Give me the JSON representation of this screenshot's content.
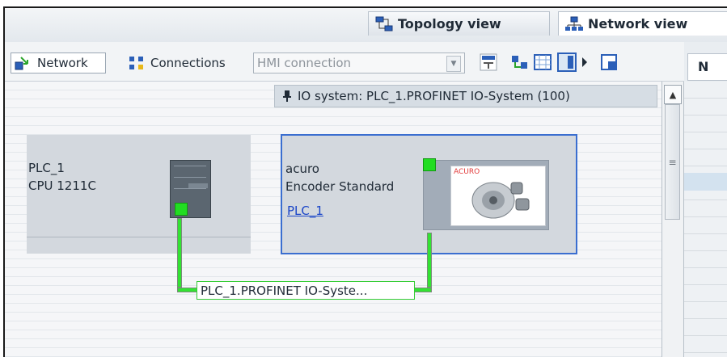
{
  "tabs": {
    "topology": "Topology view",
    "network": "Network view",
    "right_tab": "N"
  },
  "toolbar": {
    "network_label": "Network",
    "connections_label": "Connections",
    "connection_type": {
      "selected": "HMI connection"
    },
    "icons": [
      "name-icon",
      "network-conn-icon",
      "grid-icon",
      "panel-icon",
      "more-arrow-icon",
      "overview-icon"
    ]
  },
  "canvas": {
    "io_system_banner": "IO system: PLC_1.PROFINET IO-System (100)",
    "devices": [
      {
        "name": "PLC_1",
        "type": "CPU 1211C"
      },
      {
        "name": "acuro",
        "type": "Encoder Standard",
        "controller_link": "PLC_1",
        "brand": "ACURO"
      }
    ],
    "subnet_label": "PLC_1.PROFINET IO-Syste..."
  },
  "colors": {
    "port_green": "#22dd22",
    "selection_blue": "#3a6ed0",
    "link_blue": "#1c47c8"
  }
}
